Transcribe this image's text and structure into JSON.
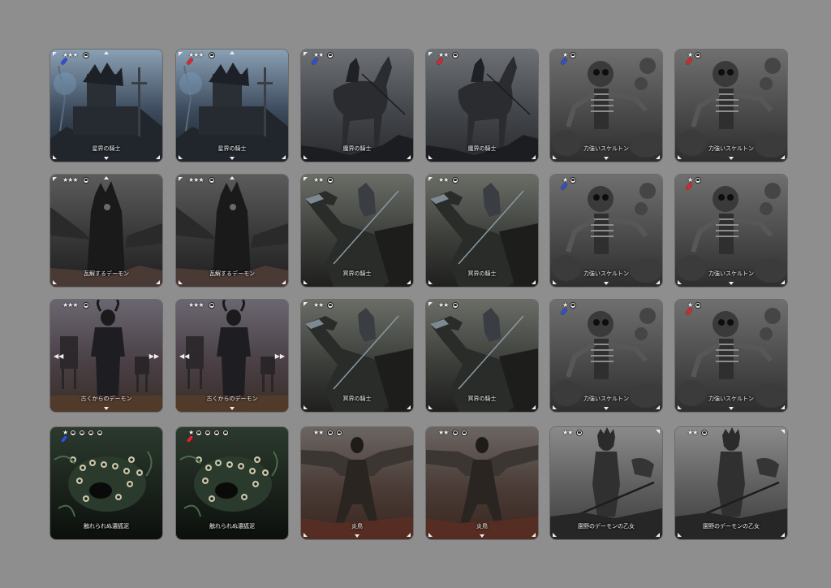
{
  "colors": {
    "background": "#8e8e8e",
    "pen_blue": "#2f4fd6",
    "pen_red": "#e0262b"
  },
  "cards": [
    {
      "name": "星界の騎士",
      "stars": "★★★",
      "pen": "blue",
      "icons": 1,
      "art": "knight-throne",
      "arrows": [
        "tl",
        "t",
        "bl",
        "b",
        "br"
      ]
    },
    {
      "name": "星界の騎士",
      "stars": "★★★",
      "pen": "red",
      "icons": 1,
      "art": "knight-throne",
      "arrows": [
        "tl",
        "t",
        "bl",
        "b",
        "br"
      ]
    },
    {
      "name": "魔界の騎士",
      "stars": "★★",
      "pen": "blue",
      "icons": 1,
      "art": "horse-rider",
      "arrows": [
        "tl",
        "bl",
        "br"
      ]
    },
    {
      "name": "魔界の騎士",
      "stars": "★★",
      "pen": "red",
      "icons": 1,
      "art": "horse-rider",
      "arrows": [
        "tl",
        "bl",
        "br"
      ]
    },
    {
      "name": "力強いスケルトン",
      "stars": "★",
      "pen": "blue",
      "icons": 1,
      "art": "skeleton",
      "arrows": [
        "bl",
        "b",
        "br"
      ]
    },
    {
      "name": "力強いスケルトン",
      "stars": "★",
      "pen": "red",
      "icons": 1,
      "art": "skeleton",
      "arrows": [
        "bl",
        "b",
        "br"
      ]
    },
    {
      "name": "瓦解するデーモン",
      "stars": "★★★",
      "pen": "",
      "icons": 1,
      "art": "demon-tower",
      "arrows": [
        "tl",
        "t",
        "bl",
        "br"
      ]
    },
    {
      "name": "瓦解するデーモン",
      "stars": "★★★",
      "pen": "",
      "icons": 1,
      "art": "demon-tower",
      "arrows": [
        "tl",
        "t",
        "bl",
        "br"
      ]
    },
    {
      "name": "冥界の騎士",
      "stars": "★★",
      "pen": "",
      "icons": 1,
      "art": "dragon-rider",
      "arrows": [
        "tl",
        "bl",
        "br"
      ]
    },
    {
      "name": "冥界の騎士",
      "stars": "★★",
      "pen": "",
      "icons": 1,
      "art": "dragon-rider",
      "arrows": [
        "tl",
        "bl",
        "br"
      ]
    },
    {
      "name": "力強いスケルトン",
      "stars": "★",
      "pen": "blue",
      "icons": 1,
      "art": "skeleton",
      "arrows": [
        "bl",
        "b",
        "br"
      ]
    },
    {
      "name": "力強いスケルトン",
      "stars": "★",
      "pen": "red",
      "icons": 1,
      "art": "skeleton",
      "arrows": [
        "bl",
        "b",
        "br"
      ]
    },
    {
      "name": "古くからのデーモン",
      "stars": "★★★",
      "pen": "",
      "icons": 1,
      "art": "horned-demon",
      "arrows": [
        "l",
        "r",
        "b"
      ]
    },
    {
      "name": "古くからのデーモン",
      "stars": "★★★",
      "pen": "",
      "icons": 1,
      "art": "horned-demon",
      "arrows": [
        "l",
        "r",
        "b"
      ]
    },
    {
      "name": "冥界の騎士",
      "stars": "★★",
      "pen": "",
      "icons": 1,
      "art": "dragon-rider",
      "arrows": [
        "tl",
        "bl",
        "br"
      ]
    },
    {
      "name": "冥界の騎士",
      "stars": "★★",
      "pen": "",
      "icons": 1,
      "art": "dragon-rider",
      "arrows": [
        "tl",
        "bl",
        "br"
      ]
    },
    {
      "name": "力強いスケルトン",
      "stars": "★",
      "pen": "blue",
      "icons": 1,
      "art": "skeleton",
      "arrows": [
        "bl",
        "b",
        "br"
      ]
    },
    {
      "name": "力強いスケルトン",
      "stars": "★",
      "pen": "red",
      "icons": 1,
      "art": "skeleton",
      "arrows": [
        "bl",
        "b",
        "br"
      ]
    },
    {
      "name": "触れられぬ濃狐泥",
      "stars": "★",
      "pen": "blue",
      "icons": 4,
      "art": "eye-swarm",
      "arrows": []
    },
    {
      "name": "触れられぬ濃狐泥",
      "stars": "★",
      "pen": "red",
      "icons": 4,
      "art": "eye-swarm",
      "arrows": []
    },
    {
      "name": "炎鳥",
      "stars": "★★",
      "pen": "",
      "icons": 2,
      "art": "winged-demon",
      "arrows": [
        "bl",
        "b",
        "br"
      ]
    },
    {
      "name": "炎鳥",
      "stars": "★★",
      "pen": "",
      "icons": 2,
      "art": "winged-demon",
      "arrows": [
        "bl",
        "b",
        "br"
      ]
    },
    {
      "name": "園野のデーモンの乙女",
      "stars": "★★",
      "pen": "",
      "icons": 1,
      "art": "spear-maiden",
      "arrows": [
        "bl",
        "br",
        "tr"
      ]
    },
    {
      "name": "園野のデーモンの乙女",
      "stars": "★★",
      "pen": "",
      "icons": 1,
      "art": "spear-maiden",
      "arrows": [
        "bl",
        "br",
        "tr"
      ]
    }
  ]
}
